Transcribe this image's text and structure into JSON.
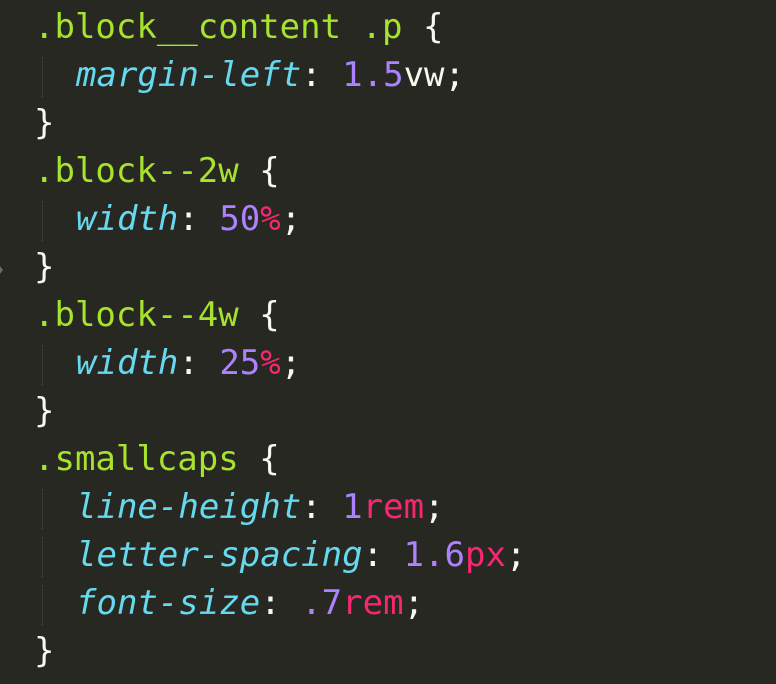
{
  "code": {
    "lines": [
      {
        "selector": ".block__content .p",
        "brace": "{"
      },
      {
        "property": "margin-left",
        "colon": ":",
        "number": "1.5",
        "unit": "vw",
        "semi": ";"
      },
      {
        "brace": "}"
      },
      {
        "selector": ".block--2w",
        "brace": "{"
      },
      {
        "property": "width",
        "colon": ":",
        "number": "50",
        "unit": "%",
        "semi": ";"
      },
      {
        "brace": "}"
      },
      {
        "selector": ".block--4w",
        "brace": "{"
      },
      {
        "property": "width",
        "colon": ":",
        "number": "25",
        "unit": "%",
        "semi": ";"
      },
      {
        "brace": "}"
      },
      {
        "selector": ".smallcaps",
        "brace": "{"
      },
      {
        "property": "line-height",
        "colon": ":",
        "number": "1",
        "unit": "rem",
        "semi": ";"
      },
      {
        "property": "letter-spacing",
        "colon": ":",
        "number": "1.6",
        "unit": "px",
        "semi": ";"
      },
      {
        "property": "font-size",
        "colon": ":",
        "number": ".7",
        "unit": "rem",
        "semi": ";"
      },
      {
        "brace": "}"
      }
    ]
  },
  "colors": {
    "background": "#272822",
    "selector": "#a6e22e",
    "property": "#66d9ef",
    "number": "#ae81ff",
    "unit": "#f92672",
    "text": "#f8f8f2"
  }
}
